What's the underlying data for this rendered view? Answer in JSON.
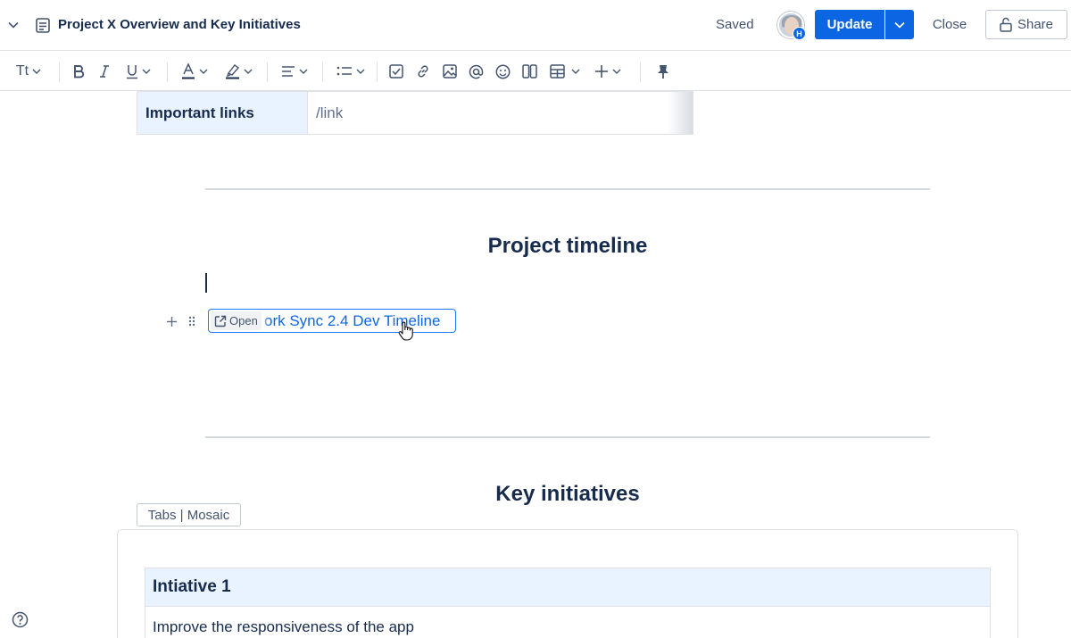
{
  "header": {
    "title": "Project X Overview and Key Initiatives",
    "status": "Saved",
    "avatar_badge": "H",
    "update_label": "Update",
    "close_label": "Close",
    "share_label": "Share"
  },
  "toolbar": {
    "text_style_label": "Tt",
    "items": [
      "text-style",
      "bold",
      "italic",
      "underline",
      "text-color",
      "highlight",
      "alignment",
      "list",
      "task",
      "link",
      "image",
      "mention",
      "emoji",
      "layout",
      "table",
      "insert",
      "pin"
    ]
  },
  "content": {
    "links_label": "Important links",
    "links_value": "/link",
    "timeline_heading": "Project timeline",
    "card_open_label": "Open",
    "card_title": "ork Sync 2.4 Dev Timeline",
    "initiatives_heading": "Key initiatives",
    "view_toggle": "Tabs | Mosaic",
    "initiative_title": "Intiative 1",
    "initiative_desc": "Improve the responsiveness of the app"
  },
  "colors": {
    "primary": "#0c66e4",
    "table_header_bg": "#e9f2ff",
    "text": "#172b4d",
    "subtle_text": "#44546f"
  }
}
